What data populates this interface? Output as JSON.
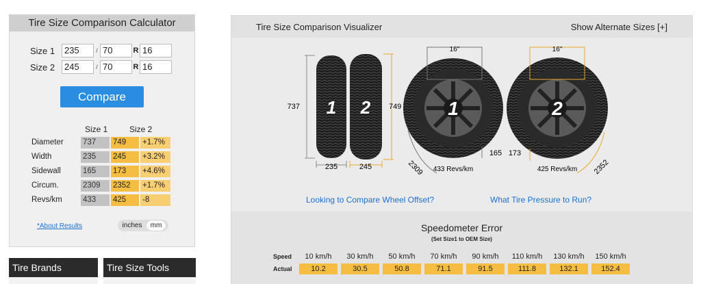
{
  "calculator": {
    "title": "Tire Size Comparison Calculator",
    "size1": {
      "label": "Size 1",
      "width": "235",
      "aspect": "70",
      "rim": "16"
    },
    "size2": {
      "label": "Size 2",
      "width": "245",
      "aspect": "70",
      "rim": "16"
    },
    "sep_slash": "/",
    "sep_r": "R",
    "compare_label": "Compare",
    "col_size1": "Size 1",
    "col_size2": "Size 2",
    "rows": [
      {
        "name": "Diameter",
        "s1": "737",
        "s2": "749",
        "diff": "+1.7%"
      },
      {
        "name": "Width",
        "s1": "235",
        "s2": "245",
        "diff": "+3.2%"
      },
      {
        "name": "Sidewall",
        "s1": "165",
        "s2": "173",
        "diff": "+4.6%"
      },
      {
        "name": "Circum.",
        "s1": "2309",
        "s2": "2352",
        "diff": "+1.7%"
      },
      {
        "name": "Revs/km",
        "s1": "433",
        "s2": "425",
        "diff": "-8"
      }
    ],
    "about_link": "*About Results",
    "unit_inches": "inches",
    "unit_mm": "mm"
  },
  "bottom_tabs": {
    "brands": "Tire Brands",
    "tools": "Tire Size Tools"
  },
  "visualizer": {
    "title": "Tire Size Comparison Visualizer",
    "alt_sizes": "Show Alternate Sizes [+]",
    "tire1_num": "1",
    "tire2_num": "2",
    "h1": "737",
    "h2": "749",
    "w1": "235",
    "w2": "245",
    "rim1": "16\"",
    "rim2": "16\"",
    "sidewall1": "165",
    "sidewall2": "173",
    "circ1": "2309",
    "circ2": "2352",
    "revs1": "433 Revs/km",
    "revs2": "425 Revs/km",
    "link_offset": "Looking to Compare Wheel Offset?",
    "link_pressure": "What Tire Pressure to Run?"
  },
  "speedometer": {
    "title": "Speedometer Error",
    "subtitle": "(Set Size1 to OEM Size)",
    "speed_label": "Speed",
    "actual_label": "Actual",
    "speeds": [
      "10 km/h",
      "30 km/h",
      "50 km/h",
      "70 km/h",
      "90 km/h",
      "110 km/h",
      "130 km/h",
      "150 km/h"
    ],
    "actuals": [
      "10.2",
      "30.5",
      "50.8",
      "71.1",
      "91.5",
      "111.8",
      "132.1",
      "152.4"
    ]
  }
}
